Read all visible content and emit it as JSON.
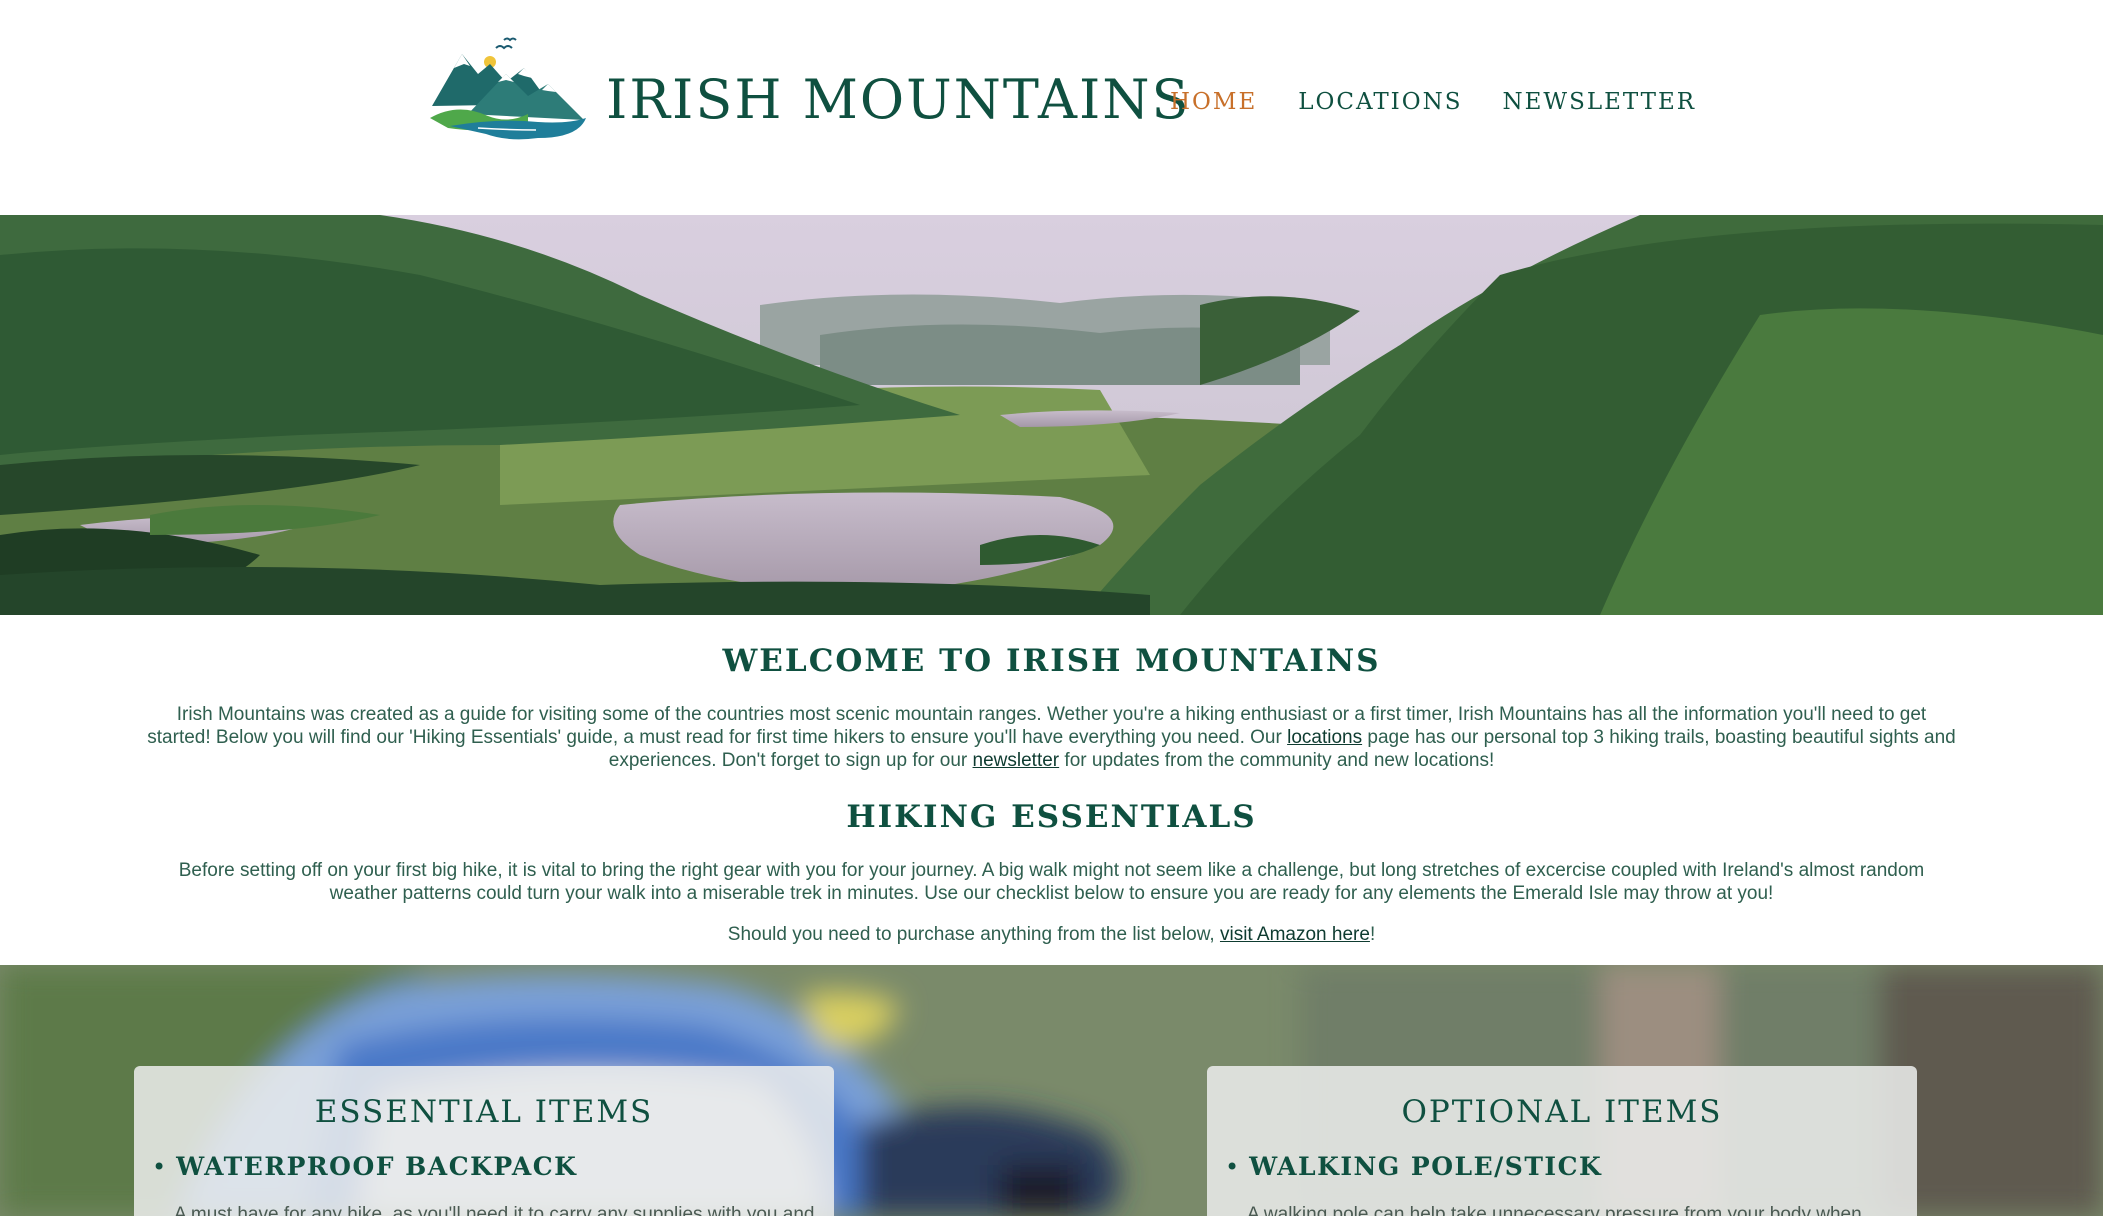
{
  "brand": {
    "name": "IRISH MOUNTAINS",
    "logo_icon": "mountain-lake-logo"
  },
  "nav": {
    "items": [
      {
        "label": "HOME",
        "active": true
      },
      {
        "label": "LOCATIONS",
        "active": false
      },
      {
        "label": "NEWSLETTER",
        "active": false
      }
    ]
  },
  "colors": {
    "brand_green": "#0f5040",
    "nav_active": "#c8702a",
    "body_text": "#2f5f4f"
  },
  "welcome": {
    "title": "WELCOME TO IRISH MOUNTAINS",
    "text_1": "Irish Mountains was created as a guide for visiting some of the countries most scenic mountain ranges. Wether you're a hiking enthusiast or a first timer, Irish Mountains has all the information you'll need to get started! Below you will find our 'Hiking Essentials' guide, a must read for first time hikers to ensure you'll have everything you need. Our ",
    "link_locations": "locations",
    "text_2": " page has our personal top 3 hiking trails, boasting beautiful sights and experiences. Don't forget to sign up for our ",
    "link_newsletter": "newsletter",
    "text_3": " for updates from the community and new locations!"
  },
  "hiking": {
    "title": "HIKING ESSENTIALS",
    "text": "Before setting off on your first big hike, it is vital to bring the right gear with you for your journey. A big walk might not seem like a challenge, but long stretches of excercise coupled with Ireland's almost random weather patterns could turn your walk into a miserable trek in minutes. Use our checklist below to ensure you are ready for any elements the Emerald Isle may throw at you!",
    "amazon_prefix": "Should you need to purchase anything from the list below, ",
    "amazon_link": "visit Amazon here",
    "amazon_suffix": "!"
  },
  "cards": {
    "essential": {
      "title": "ESSENTIAL ITEMS",
      "bullet": "•",
      "item_title": "WATERPROOF BACKPACK",
      "item_desc": "A must have for any hike, as you'll need it to carry any supplies with you and"
    },
    "optional": {
      "title": "OPTIONAL ITEMS",
      "bullet": "•",
      "item_title": "WALKING POLE/STICK",
      "item_desc": "A walking pole can help take unnecessary pressure from your body when"
    }
  }
}
